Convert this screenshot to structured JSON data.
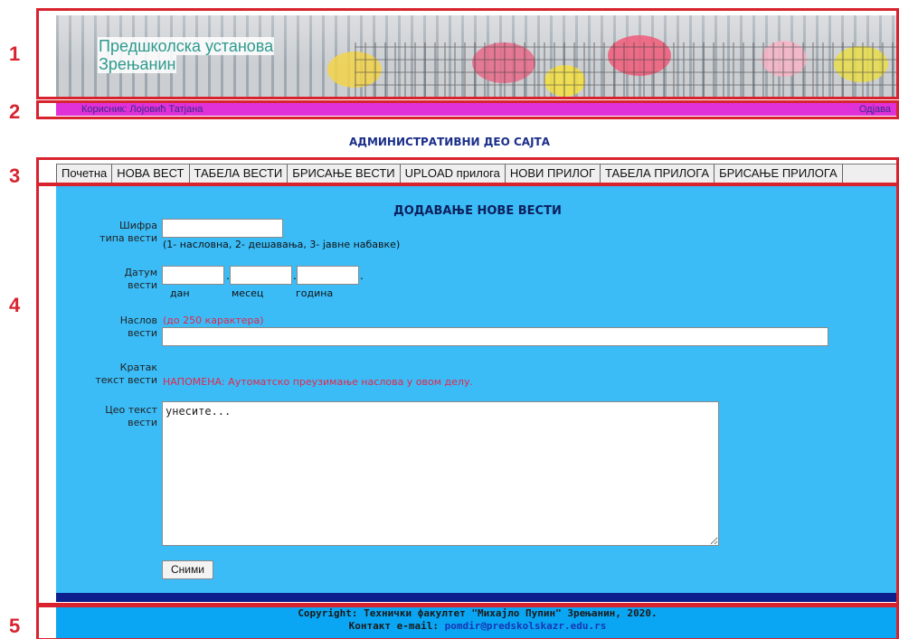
{
  "header": {
    "title_line1": "Предшколска установа",
    "title_line2": "Зрењанин"
  },
  "userbar": {
    "user_label": "Корисник: Лојовић Татјана",
    "logout_label": "Одјава"
  },
  "admin_title": "АДМИНИСТРАТИВНИ ДЕО САЈТА",
  "nav": {
    "items": [
      "Почетна",
      "НОВА ВЕСТ",
      "ТАБЕЛА ВЕСТИ",
      "БРИСАЊЕ ВЕСТИ",
      "UPLOAD прилога",
      "НОВИ ПРИЛОГ",
      "ТАБЕЛА ПРИЛОГА",
      "БРИСАЊЕ ПРИЛОГА"
    ]
  },
  "form": {
    "title": "ДОДАВАЊЕ НОВЕ ВЕСТИ",
    "type_label_1": "Шифра",
    "type_label_2": "типа вести",
    "type_hint": "(1- насловна, 2- дешавања, 3- јавне набавке)",
    "date_label_1": "Датум",
    "date_label_2": "вести",
    "day_label": "дан",
    "month_label": "месец",
    "year_label": "година",
    "title_label_1": "Наслов",
    "title_label_2": "вести",
    "title_hint": "(до 250 карактера)",
    "short_label_1": "Кратак",
    "short_label_2": "текст вести",
    "short_note": "НАПОМЕНА: Аутоматско преузимање наслова у овом делу.",
    "full_label_1": "Цео текст",
    "full_label_2": "вести",
    "full_value": "унесите...",
    "submit_label": "Сними"
  },
  "footer": {
    "copyright": "Copyright: Технички факултет \"Михајло Пупин\" Зрењанин, 2020.",
    "contact_label": "Контакт e-mail: ",
    "contact_email": "pomdir@predskolskazr.edu.rs"
  },
  "annotations": {
    "n1": "1",
    "n2": "2",
    "n3": "3",
    "n4": "4",
    "n5": "5"
  },
  "colors": {
    "annotation": "#d8232f",
    "userbar": "#e030d8",
    "panel": "#3bbcf7",
    "footer": "#0aa6f3"
  }
}
